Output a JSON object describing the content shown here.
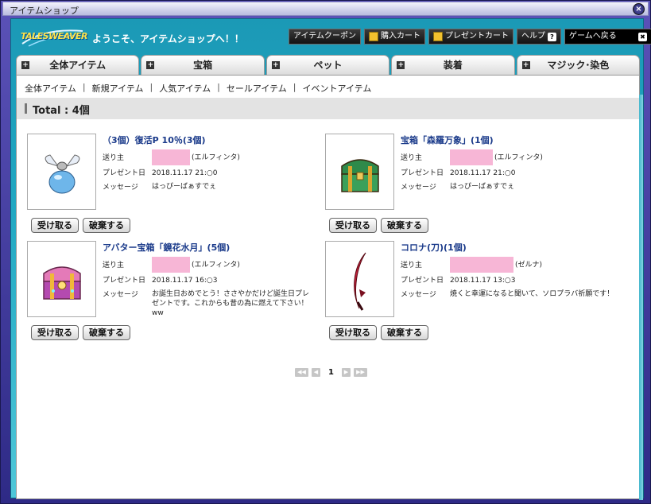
{
  "window": {
    "title": "アイテムショップ",
    "close_label": "×"
  },
  "header": {
    "logo_text": "TALESWEAVER",
    "welcome": "ようこそ、アイテムショップへ！！",
    "buttons": {
      "coupon": "アイテムクーポン",
      "cart": "購入カート",
      "present": "プレゼントカート",
      "help": "ヘルプ",
      "help_icon": "?",
      "game": "ゲームへ戻る",
      "game_icon": "✖"
    }
  },
  "tabs": [
    {
      "label": "全体アイテム"
    },
    {
      "label": "宝箱"
    },
    {
      "label": "ペット"
    },
    {
      "label": "装着"
    },
    {
      "label": "マジック･染色"
    }
  ],
  "subnav": [
    "全体アイテム",
    "新規アイテム",
    "人気アイテム",
    "セールアイテム",
    "イベントアイテム"
  ],
  "subnav_sep": "|",
  "total": "Total : 4個",
  "labels": {
    "sender": "送り主",
    "date": "プレゼント日",
    "message": "メッセージ",
    "receive": "受け取る",
    "discard": "破棄する"
  },
  "items": [
    {
      "name": "（3個）復活P 10％(3個)",
      "sender_server": "(エルフィンタ)",
      "date": "2018.11.17 21:○0",
      "message_lines": [
        "はっぴーばぁすでぇ"
      ],
      "icon": "revive-potion-icon"
    },
    {
      "name": "宝箱「森羅万象」(1個)",
      "sender_server": "(エルフィンタ)",
      "date": "2018.11.17 21:○0",
      "message_lines": [
        "はっぴーばぁすでぇ"
      ],
      "icon": "green-treasure-chest-icon"
    },
    {
      "name": "アバター宝箱「鏡花水月」(5個)",
      "sender_server": "(エルフィンタ)",
      "date": "2018.11.17 16:○3",
      "message_lines": [
        "お誕生日おめでとう！ささやかだけど誕生日プレ",
        "ゼントです。これからも昔の為に燃えて下さい！",
        "ww"
      ],
      "icon": "pink-treasure-chest-icon"
    },
    {
      "name": "コロナ(刀)(1個)",
      "sender_server": "(ゼルナ)",
      "date": "2018.11.17 13:○3",
      "message_lines": [
        "焼くと幸運になると聞いて、ソロプラバ祈願です！"
      ],
      "icon": "corona-sword-icon"
    }
  ],
  "pager": {
    "first": "◀◀",
    "prev": "◀",
    "page": "1",
    "next": "▶",
    "last": "▶▶"
  },
  "colors": {
    "accent": "#21a8c2",
    "link": "#1a3a8a",
    "sender_mask": "#f7b6d6"
  }
}
